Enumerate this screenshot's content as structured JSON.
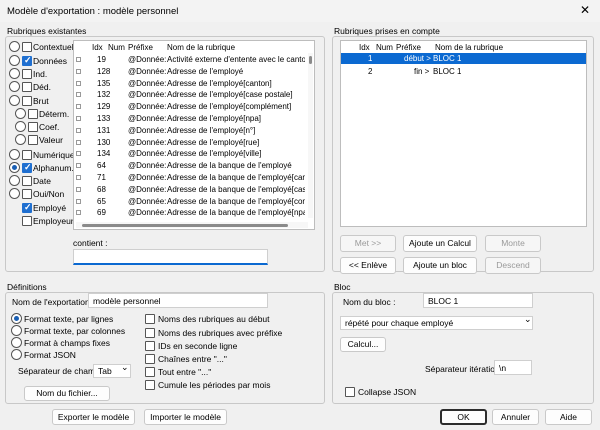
{
  "window": {
    "title": "Modèle d'exportation : modèle personnel",
    "close_glyph": "✕"
  },
  "rubriques_existantes": {
    "label": "Rubriques existantes",
    "filters": [
      {
        "label": "Contextuel",
        "radio": false,
        "checked": false
      },
      {
        "label": "Données",
        "radio": false,
        "checked": true
      },
      {
        "label": "Ind.",
        "radio": false,
        "checked": false
      },
      {
        "label": "Déd.",
        "radio": false,
        "checked": false
      },
      {
        "label": "Brut",
        "radio": false,
        "checked": false
      },
      {
        "label": "Déterm.",
        "radio": false,
        "checked": false
      },
      {
        "label": "Coef.",
        "radio": false,
        "checked": false
      },
      {
        "label": "Valeur",
        "radio": false,
        "checked": false
      },
      {
        "label": "Numérique",
        "radio": false,
        "checked": false
      },
      {
        "label": "Alphanum.",
        "radio": true,
        "checked": true
      },
      {
        "label": "Date",
        "radio": false,
        "checked": false
      },
      {
        "label": "Oui/Non",
        "radio": false,
        "checked": false
      },
      {
        "label": "Employé",
        "checked": true
      },
      {
        "label": "Employeur",
        "checked": false
      }
    ],
    "columns": [
      "Idx",
      "Num",
      "Préfixe",
      "Nom de la rubrique"
    ],
    "rows": [
      {
        "idx": "19",
        "num": "",
        "prefix": "@Donnée:",
        "name": "Activité externe d'entente avec le canton (EL"
      },
      {
        "idx": "128",
        "num": "",
        "prefix": "@Donnée:",
        "name": "Adresse de l'employé"
      },
      {
        "idx": "135",
        "num": "",
        "prefix": "@Donnée:",
        "name": "Adresse de l'employé[canton]"
      },
      {
        "idx": "132",
        "num": "",
        "prefix": "@Donnée:",
        "name": "Adresse de l'employé[case postale]"
      },
      {
        "idx": "129",
        "num": "",
        "prefix": "@Donnée:",
        "name": "Adresse de l'employé[complément]"
      },
      {
        "idx": "133",
        "num": "",
        "prefix": "@Donnée:",
        "name": "Adresse de l'employé[npa]"
      },
      {
        "idx": "131",
        "num": "",
        "prefix": "@Donnée:",
        "name": "Adresse de l'employé[n°]"
      },
      {
        "idx": "130",
        "num": "",
        "prefix": "@Donnée:",
        "name": "Adresse de l'employé[rue]"
      },
      {
        "idx": "134",
        "num": "",
        "prefix": "@Donnée:",
        "name": "Adresse de l'employé[ville]"
      },
      {
        "idx": "64",
        "num": "",
        "prefix": "@Donnée:",
        "name": "Adresse de la banque de l'employé"
      },
      {
        "idx": "71",
        "num": "",
        "prefix": "@Donnée:",
        "name": "Adresse de la banque de l'employé[canton]"
      },
      {
        "idx": "68",
        "num": "",
        "prefix": "@Donnée:",
        "name": "Adresse de la banque de l'employé[case pos"
      },
      {
        "idx": "65",
        "num": "",
        "prefix": "@Donnée:",
        "name": "Adresse de la banque de l'employé[complém"
      },
      {
        "idx": "69",
        "num": "",
        "prefix": "@Donnée:",
        "name": "Adresse de la banque de l'employé[npa]"
      }
    ],
    "contient_label": "contient :",
    "contient_value": ""
  },
  "rubriques_prises": {
    "label": "Rubriques prises en compte",
    "columns": [
      "Idx",
      "Num",
      "Préfixe",
      "Nom de la rubrique"
    ],
    "rows": [
      {
        "idx": "1",
        "num": "",
        "prefix": "début >",
        "name": "BLOC 1",
        "selected": true
      },
      {
        "idx": "2",
        "num": "",
        "prefix": "fin >",
        "name": "BLOC 1",
        "selected": false
      }
    ],
    "buttons": {
      "met": "Met >>",
      "ajoute_calcul": "Ajoute un Calcul",
      "monte": "Monte",
      "enleve": "<< Enlève",
      "ajoute_bloc": "Ajoute un bloc",
      "descend": "Descend"
    }
  },
  "definitions": {
    "label": "Définitions",
    "nom_label": "Nom de l'exportation",
    "nom_value": "modèle personnel",
    "formats": [
      {
        "label": "Format texte, par lignes",
        "selected": true
      },
      {
        "label": "Format texte, par colonnes",
        "selected": false
      },
      {
        "label": "Format à champs fixes",
        "selected": false
      },
      {
        "label": "Format JSON",
        "selected": false
      }
    ],
    "options": [
      {
        "label": "Noms des rubriques au début",
        "checked": false
      },
      {
        "label": "Noms des rubriques avec préfixe",
        "checked": false
      },
      {
        "label": "IDs en seconde ligne",
        "checked": false
      },
      {
        "label": "Chaînes entre \"...\"",
        "checked": false
      },
      {
        "label": "Tout entre \"...\"",
        "checked": false
      },
      {
        "label": "Cumule les périodes par mois",
        "checked": false
      }
    ],
    "separateur_label": "Séparateur de champs :",
    "separateur_value": "Tab",
    "nom_fichier_button": "Nom du fichier..."
  },
  "bloc": {
    "label": "Bloc",
    "nom_label": "Nom du bloc :",
    "nom_value": "BLOC 1",
    "repeat_value": "répété pour chaque employé",
    "calcul_button": "Calcul...",
    "separateur_label": "Séparateur itération :",
    "separateur_value": "\\n",
    "collapse_label": "Collapse JSON",
    "collapse_checked": false
  },
  "footer": {
    "exporter": "Exporter le modèle",
    "importer": "Importer le modèle",
    "ok": "OK",
    "annuler": "Annuler",
    "aide": "Aide"
  },
  "colors": {
    "accent": "#0b69d1",
    "check": "#1f6fd0"
  }
}
